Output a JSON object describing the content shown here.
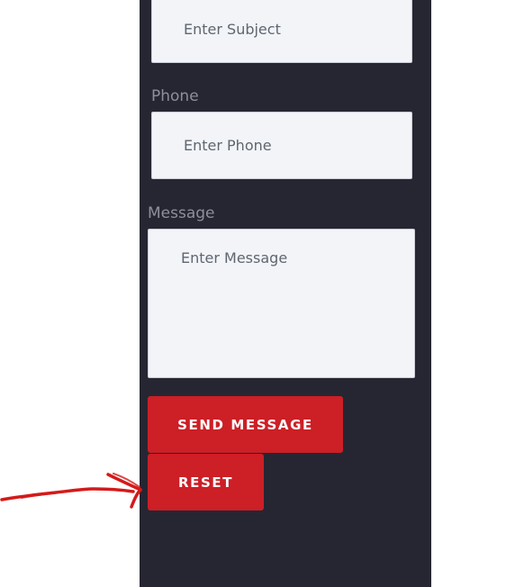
{
  "form": {
    "subject": {
      "placeholder": "Enter Subject"
    },
    "phone": {
      "label": "Phone",
      "placeholder": "Enter Phone"
    },
    "message": {
      "label": "Message",
      "placeholder": "Enter Message"
    },
    "send_button_label": "SEND MESSAGE",
    "reset_button_label": "RESET"
  },
  "colors": {
    "panel_background": "#262633",
    "button_background": "#cc1f26",
    "annotation_arrow": "#d41a1a",
    "field_background": "#f2f4f8"
  },
  "annotation": {
    "icon": "hand-drawn-red-arrow-icon"
  }
}
